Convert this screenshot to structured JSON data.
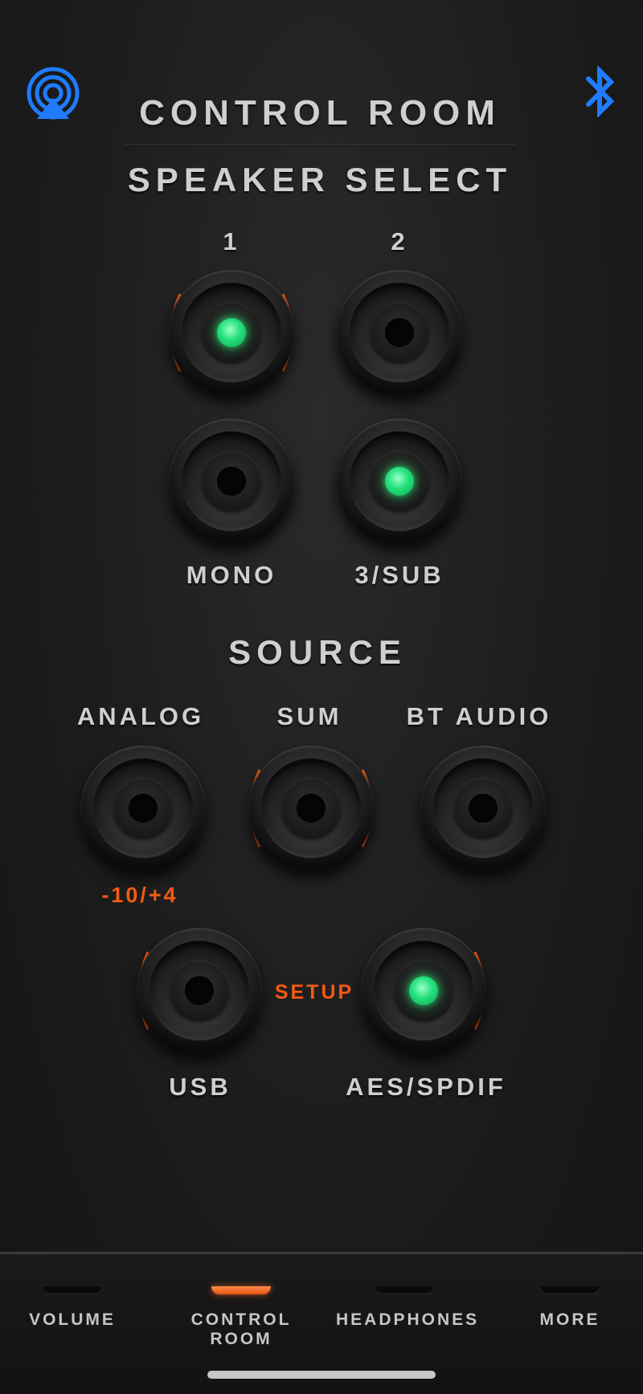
{
  "header": {
    "title": "CONTROL ROOM",
    "airplay_icon": "airplay-icon",
    "bluetooth_icon": "bluetooth-icon",
    "accent_color": "#1f7bff"
  },
  "speaker_select": {
    "title": "SPEAKER SELECT",
    "buttons": [
      {
        "label": "1",
        "active": true
      },
      {
        "label": "2",
        "active": false
      },
      {
        "label": "MONO",
        "active": false
      },
      {
        "label": "3/SUB",
        "active": true
      }
    ]
  },
  "source": {
    "title": "SOURCE",
    "buttons": [
      {
        "label": "ANALOG",
        "active": false
      },
      {
        "label": "SUM",
        "active": false
      },
      {
        "label": "BT AUDIO",
        "active": false
      },
      {
        "label": "USB",
        "active": false
      },
      {
        "label": "AES/SPDIF",
        "active": true
      }
    ],
    "analog_level_label": "-10/+4",
    "setup_label": "SETUP"
  },
  "nav": {
    "items": [
      {
        "label": "VOLUME",
        "active": false
      },
      {
        "label": "CONTROL ROOM",
        "active": true
      },
      {
        "label": "HEADPHONES",
        "active": false
      },
      {
        "label": "MORE",
        "active": false
      }
    ]
  },
  "colors": {
    "led_on": "#22e07a",
    "accent_orange": "#f25a12"
  }
}
